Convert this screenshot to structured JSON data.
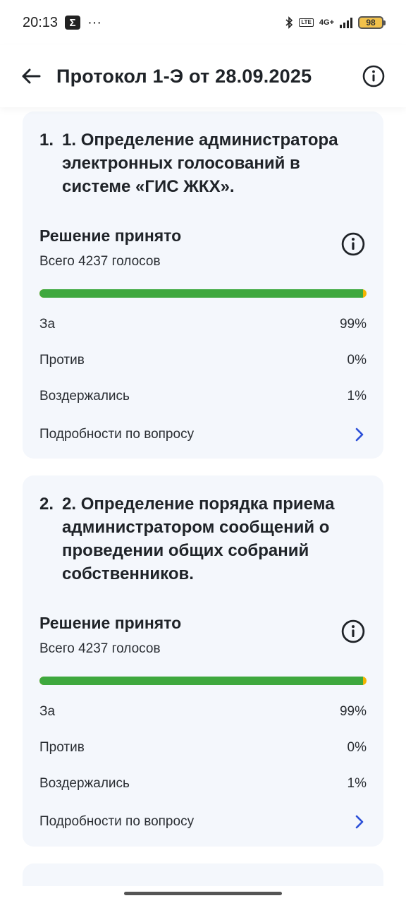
{
  "status_bar": {
    "time": "20:13",
    "sigma": "Σ",
    "dots": "···",
    "network": "4G+",
    "lte": "LTE",
    "battery": "98"
  },
  "header": {
    "title": "Протокол 1-Э от 28.09.2025",
    "back_icon": "arrow-left-icon",
    "info_icon": "info-circle-icon"
  },
  "questions": [
    {
      "number": "1.",
      "title": "1. Определение администратора электронных голосований в системе «ГИС ЖКХ».",
      "decision": "Решение принято",
      "total": "Всего 4237 голосов",
      "for_fraction": 0.99,
      "rows": [
        {
          "label": "За",
          "value": "99%"
        },
        {
          "label": "Против",
          "value": "0%"
        },
        {
          "label": "Воздержались",
          "value": "1%"
        }
      ],
      "details": "Подробности по вопросу"
    },
    {
      "number": "2.",
      "title": "2. Определение порядка приема администратором сообщений о проведении общих собраний собственников.",
      "decision": "Решение принято",
      "total": "Всего 4237 голосов",
      "for_fraction": 0.99,
      "rows": [
        {
          "label": "За",
          "value": "99%"
        },
        {
          "label": "Против",
          "value": "0%"
        },
        {
          "label": "Воздержались",
          "value": "1%"
        }
      ],
      "details": "Подробности по вопросу"
    }
  ],
  "colors": {
    "for": "#3ea83e",
    "abstain": "#f4b400",
    "accent": "#2b4fd8",
    "card_bg": "#f4f7fc"
  }
}
